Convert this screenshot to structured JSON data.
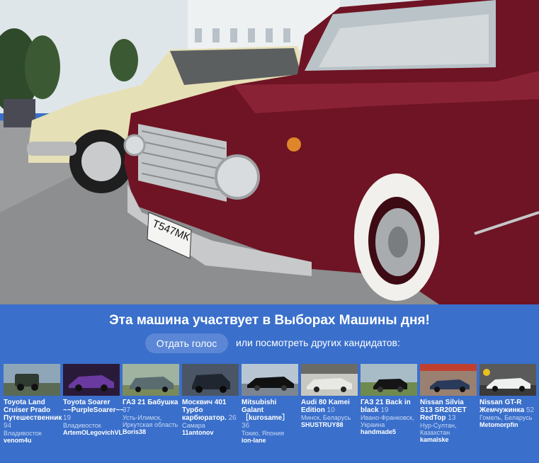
{
  "colors": {
    "panel": "#3a6fcb",
    "button": "#5b87d6"
  },
  "hero": {
    "plate_text": "Т547МК",
    "icon": "car-photo"
  },
  "banner": {
    "title": "Эта машина участвует в Выборах Машины дня!",
    "vote_button": "Отдать голос",
    "or_text": "или посмотреть других кандидатов:"
  },
  "candidates": [
    {
      "name": "Toyota Land Cruiser Prado Путешественник",
      "count": "94",
      "location": "Владивосток",
      "user": "venom4u",
      "thumb_color": "#5a6a55"
    },
    {
      "name": "Toyota Soarer ~~PurpleSoarer~~",
      "count": "19",
      "location": "Владивосток",
      "user": "ArtemOLegovichVL",
      "thumb_color": "#3a2a4a"
    },
    {
      "name": "ГАЗ 21 Бабушка",
      "count": "37",
      "location": "Усть-Илимск, Иркутская область",
      "user": "Boris38",
      "thumb_color": "#6d7a5a"
    },
    {
      "name": "Москвич 401 Турбо карбюратор.",
      "count": "26",
      "location": "Самара",
      "user": "11antonov",
      "thumb_color": "#3d4a5a"
    },
    {
      "name": "Mitsubishi Galant ［kurosame］",
      "count": "36",
      "location": "Токио, Япония",
      "user": "ion-lane",
      "thumb_color": "#8a93a0"
    },
    {
      "name": "Audi 80 Kamei Edition",
      "count": "10",
      "location": "Минск, Беларусь",
      "user": "SHUSTRUY88",
      "thumb_color": "#a5a5a0"
    },
    {
      "name": "ГАЗ 21 Back in black",
      "count": "19",
      "location": "Ивано-Франковск, Украина",
      "user": "handmade5",
      "thumb_color": "#6f8a4e"
    },
    {
      "name": "Nissan Silvia S13 SR20DET RedTop",
      "count": "13",
      "location": "Нур-Султан, Казахстан",
      "user": "kamalske",
      "thumb_color": "#8a6a5a"
    },
    {
      "name": "Nissan GT-R Жемчужинка",
      "count": "52",
      "location": "Гомель, Беларусь",
      "user": "Metomorpfin",
      "thumb_color": "#5a5a5a"
    }
  ]
}
